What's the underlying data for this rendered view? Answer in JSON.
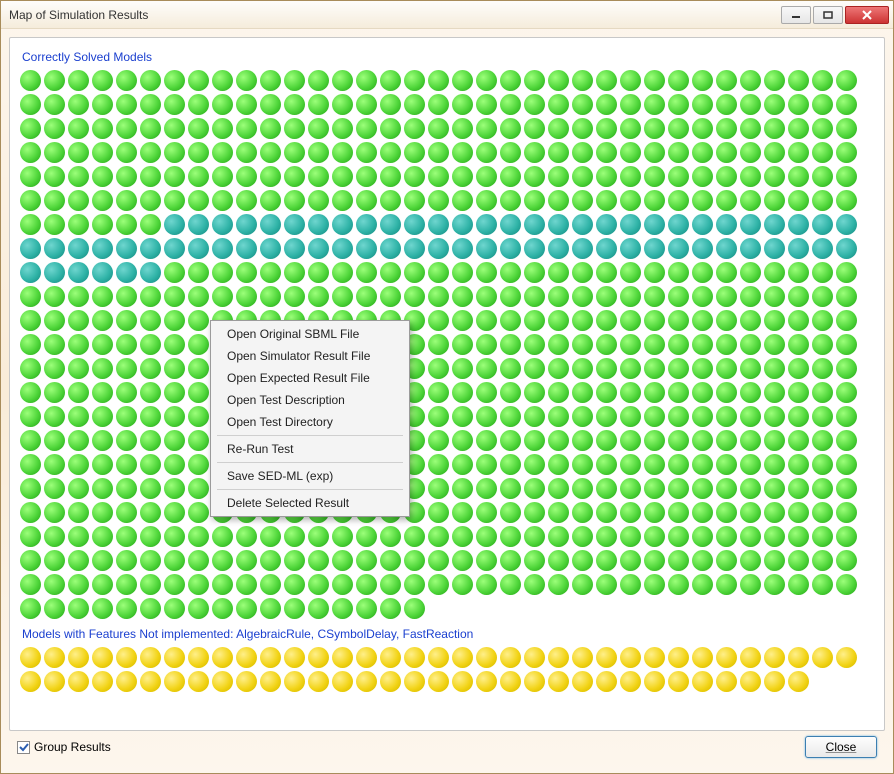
{
  "window": {
    "title": "Map of Simulation Results"
  },
  "sections": {
    "correct": {
      "label": "Correctly Solved Models",
      "rows": [
        {
          "color": "green",
          "count": 35
        },
        {
          "color": "green",
          "count": 35
        },
        {
          "color": "green",
          "count": 35
        },
        {
          "color": "green",
          "count": 35
        },
        {
          "color": "green",
          "count": 35
        },
        {
          "color": "green",
          "count": 35
        },
        {
          "color": "split",
          "count": 35,
          "green": 6,
          "teal": 29
        },
        {
          "color": "teal",
          "count": 35
        },
        {
          "color": "split2",
          "count": 35,
          "teal": 6,
          "green": 29
        },
        {
          "color": "green",
          "count": 35
        },
        {
          "color": "green",
          "count": 35
        },
        {
          "color": "green",
          "count": 35
        },
        {
          "color": "green",
          "count": 35
        },
        {
          "color": "green",
          "count": 35
        },
        {
          "color": "green",
          "count": 35
        },
        {
          "color": "green",
          "count": 35
        },
        {
          "color": "green",
          "count": 35
        },
        {
          "color": "green",
          "count": 35
        },
        {
          "color": "green",
          "count": 35
        },
        {
          "color": "green",
          "count": 35
        },
        {
          "color": "green",
          "count": 35
        },
        {
          "color": "green",
          "count": 35
        },
        {
          "color": "green",
          "count": 17
        }
      ]
    },
    "not_implemented": {
      "label": "Models with Features Not implemented: AlgebraicRule, CSymbolDelay, FastReaction",
      "rows": [
        {
          "color": "yellow",
          "count": 35
        },
        {
          "color": "yellow",
          "count": 33
        }
      ]
    }
  },
  "context_menu": {
    "groups": [
      [
        "Open Original SBML File",
        "Open Simulator Result File",
        "Open Expected Result File",
        "Open Test Description",
        "Open Test Directory"
      ],
      [
        "Re-Run Test"
      ],
      [
        "Save SED-ML (exp)"
      ],
      [
        "Delete Selected Result"
      ]
    ]
  },
  "footer": {
    "group_results_label": "Group Results",
    "group_results_checked": true,
    "close_label": "Close"
  }
}
